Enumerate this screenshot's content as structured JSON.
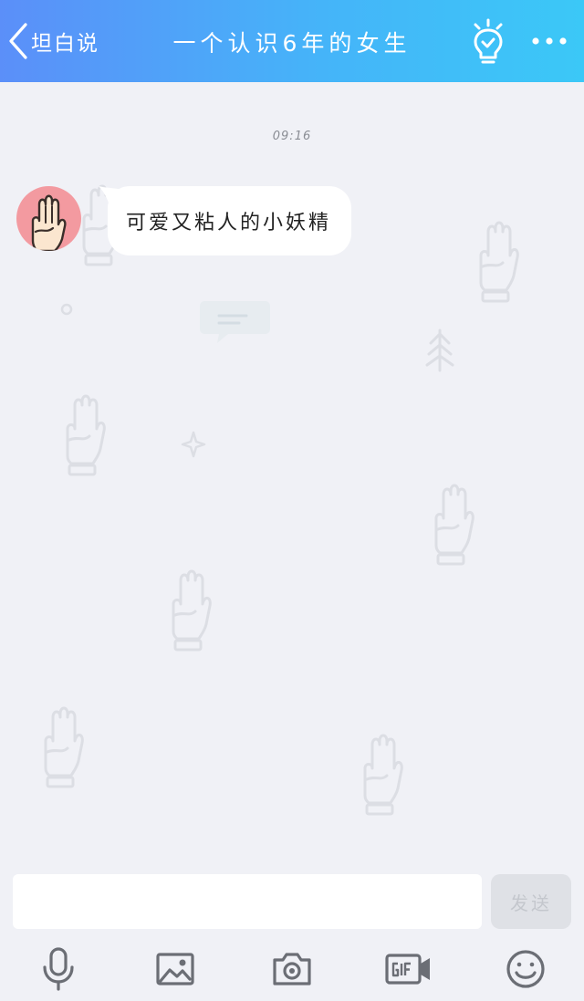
{
  "header": {
    "back_label": "坦白说",
    "title": "一个认识6年的女生"
  },
  "chat": {
    "timestamp": "09:16",
    "messages": [
      {
        "text": "可爱又粘人的小妖精"
      }
    ]
  },
  "composer": {
    "input_value": "",
    "input_placeholder": "",
    "send_label": "发送"
  },
  "toolbar": {
    "items": [
      "microphone-icon",
      "image-icon",
      "camera-icon",
      "gif-icon",
      "emoji-icon"
    ]
  },
  "colors": {
    "header_gradient_start": "#5b8ff9",
    "header_gradient_end": "#3bc8f7",
    "background": "#f0f1f6",
    "avatar_bg": "#f39aa0"
  }
}
